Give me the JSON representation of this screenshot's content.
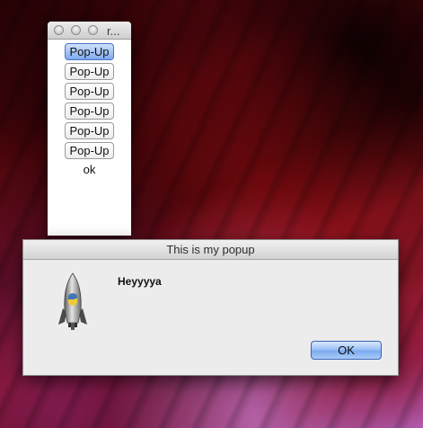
{
  "main_window": {
    "title": "r...",
    "popup_buttons": [
      {
        "label": "Pop-Up",
        "active": true
      },
      {
        "label": "Pop-Up",
        "active": false
      },
      {
        "label": "Pop-Up",
        "active": false
      },
      {
        "label": "Pop-Up",
        "active": false
      },
      {
        "label": "Pop-Up",
        "active": false
      },
      {
        "label": "Pop-Up",
        "active": false
      }
    ],
    "status_text": "ok"
  },
  "dialog": {
    "title": "This is my popup",
    "message": "Heyyyya",
    "icon": "python-rocket-icon",
    "ok_label": "OK"
  },
  "colors": {
    "desktop_base": "#6e0810",
    "button_accent": "#7faaf0"
  }
}
